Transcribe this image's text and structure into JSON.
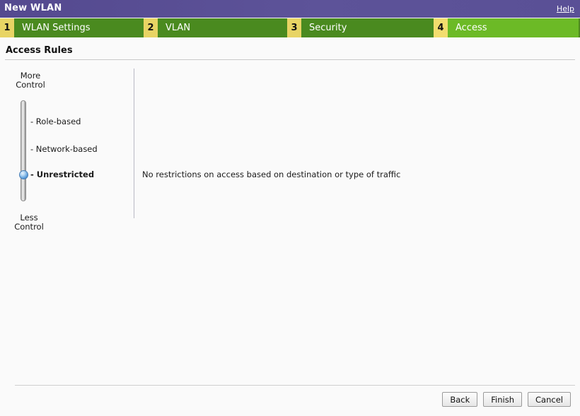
{
  "window": {
    "title": "New WLAN",
    "help_label": "Help"
  },
  "wizard": {
    "tabs": [
      {
        "number": "1",
        "label": "WLAN Settings",
        "active": false
      },
      {
        "number": "2",
        "label": "VLAN",
        "active": false
      },
      {
        "number": "3",
        "label": "Security",
        "active": false
      },
      {
        "number": "4",
        "label": "Access",
        "active": true
      }
    ]
  },
  "section": {
    "title": "Access Rules"
  },
  "slider": {
    "top_caption": "More\nControl",
    "top_caption_line1": "More",
    "top_caption_line2": "Control",
    "bottom_caption_line1": "Less",
    "bottom_caption_line2": "Control",
    "selected_value": "Unrestricted",
    "stops": [
      {
        "label": "- Role-based",
        "selected": false
      },
      {
        "label": "- Network-based",
        "selected": false
      },
      {
        "label": "- Unrestricted",
        "selected": true
      }
    ]
  },
  "detail": {
    "description": "No restrictions on access based on destination or type of traffic"
  },
  "footer": {
    "buttons": [
      {
        "label": "Back"
      },
      {
        "label": "Finish"
      },
      {
        "label": "Cancel"
      }
    ]
  },
  "colors": {
    "title_bar_purple": "#5a5096",
    "tab_green": "#4a8a1f",
    "tab_active_green": "#6cba26",
    "tab_number_yellow": "#e8d464",
    "knob_blue": "#5d9fdc",
    "page_background": "#fafafa"
  }
}
